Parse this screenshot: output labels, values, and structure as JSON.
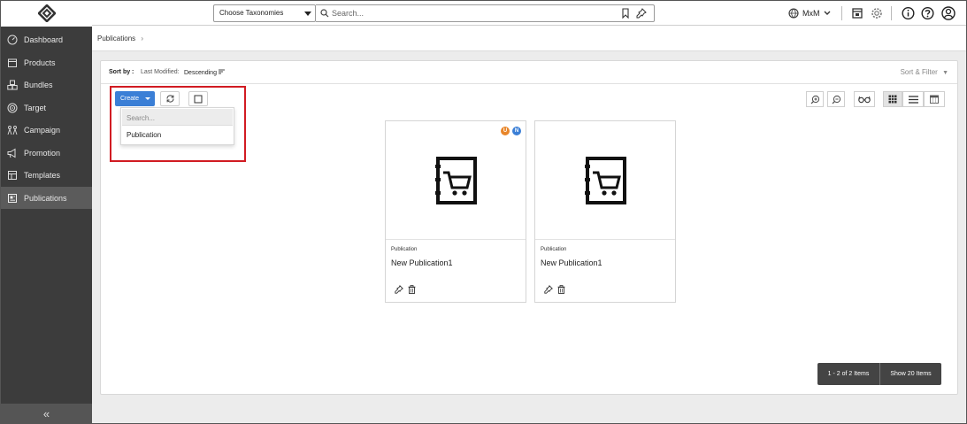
{
  "header": {
    "taxonomy_select": "Choose Taxonomies",
    "search_placeholder": "Search...",
    "user": "MxM"
  },
  "sidebar": {
    "items": [
      {
        "label": "Dashboard",
        "icon": "dashboard-icon"
      },
      {
        "label": "Products",
        "icon": "products-icon"
      },
      {
        "label": "Bundles",
        "icon": "bundles-icon"
      },
      {
        "label": "Target",
        "icon": "target-icon"
      },
      {
        "label": "Campaign",
        "icon": "campaign-icon"
      },
      {
        "label": "Promotion",
        "icon": "promotion-icon"
      },
      {
        "label": "Templates",
        "icon": "templates-icon"
      },
      {
        "label": "Publications",
        "icon": "publications-icon",
        "active": true
      }
    ],
    "collapse": "«"
  },
  "breadcrumb": {
    "current": "Publications",
    "sep": "›"
  },
  "sort": {
    "label": "Sort by :",
    "field": "Last Modified:",
    "order": "Descending",
    "sort_filter": "Sort & Filter"
  },
  "toolbar": {
    "create_label": "Create"
  },
  "create_menu": {
    "search_placeholder": "Search...",
    "items": [
      "Publication"
    ]
  },
  "cards": [
    {
      "type": "Publication",
      "title": "New Publication1",
      "badges": [
        {
          "letter": "U",
          "color": "#e8862a"
        },
        {
          "letter": "N",
          "color": "#3b7fd6"
        }
      ]
    },
    {
      "type": "Publication",
      "title": "New Publication1",
      "badges": []
    }
  ],
  "pager": {
    "range": "1 - 2 of 2 Items",
    "show": "Show 20 Items"
  }
}
